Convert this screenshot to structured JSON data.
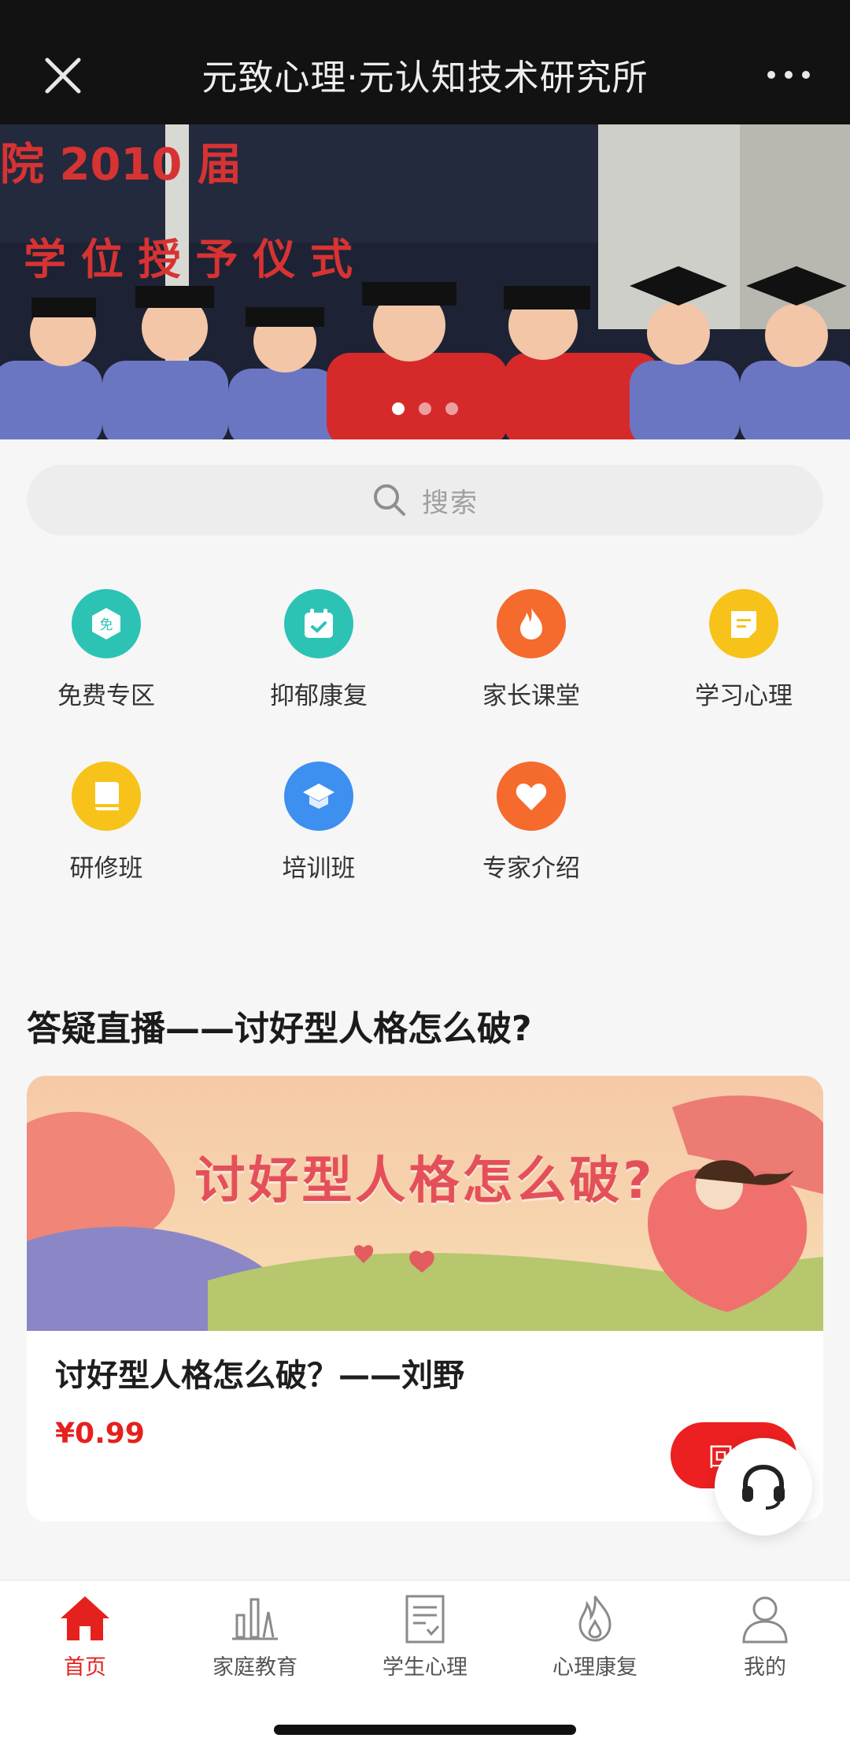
{
  "header": {
    "title": "元致心理·元认知技术研究所"
  },
  "banner": {
    "slide_count": 3,
    "active_slide": 1,
    "banner_lines": [
      "院 2010 届",
      "学 位 授 予 仪 式"
    ]
  },
  "search": {
    "placeholder": "搜索"
  },
  "categories": [
    {
      "label": "免费专区",
      "icon": "free-badge-icon",
      "color": "#2cc3b5"
    },
    {
      "label": "抑郁康复",
      "icon": "calendar-check-icon",
      "color": "#2cc3b5"
    },
    {
      "label": "家长课堂",
      "icon": "flame-icon",
      "color": "#f56a2d"
    },
    {
      "label": "学习心理",
      "icon": "note-icon",
      "color": "#f7c31a"
    },
    {
      "label": "研修班",
      "icon": "book-icon",
      "color": "#f7c31a"
    },
    {
      "label": "培训班",
      "icon": "graduation-cap-icon",
      "color": "#3d8ff0"
    },
    {
      "label": "专家介绍",
      "icon": "heart-icon",
      "color": "#f56a2d"
    }
  ],
  "section": {
    "title": "答疑直播——讨好型人格怎么破?"
  },
  "course_card": {
    "cover_text": "讨好型人格怎么破?",
    "title": "讨好型人格怎么破？——刘野",
    "price": "¥0.99",
    "replay_label": "回看"
  },
  "tabbar": {
    "items": [
      {
        "label": "首页",
        "icon": "home-icon",
        "active": true
      },
      {
        "label": "家庭教育",
        "icon": "bar-chart-icon",
        "active": false
      },
      {
        "label": "学生心理",
        "icon": "document-icon",
        "active": false
      },
      {
        "label": "心理康复",
        "icon": "flame-outline-icon",
        "active": false
      },
      {
        "label": "我的",
        "icon": "user-icon",
        "active": false
      }
    ]
  },
  "colors": {
    "accent": "#e5211d",
    "header_bg": "#121212"
  }
}
